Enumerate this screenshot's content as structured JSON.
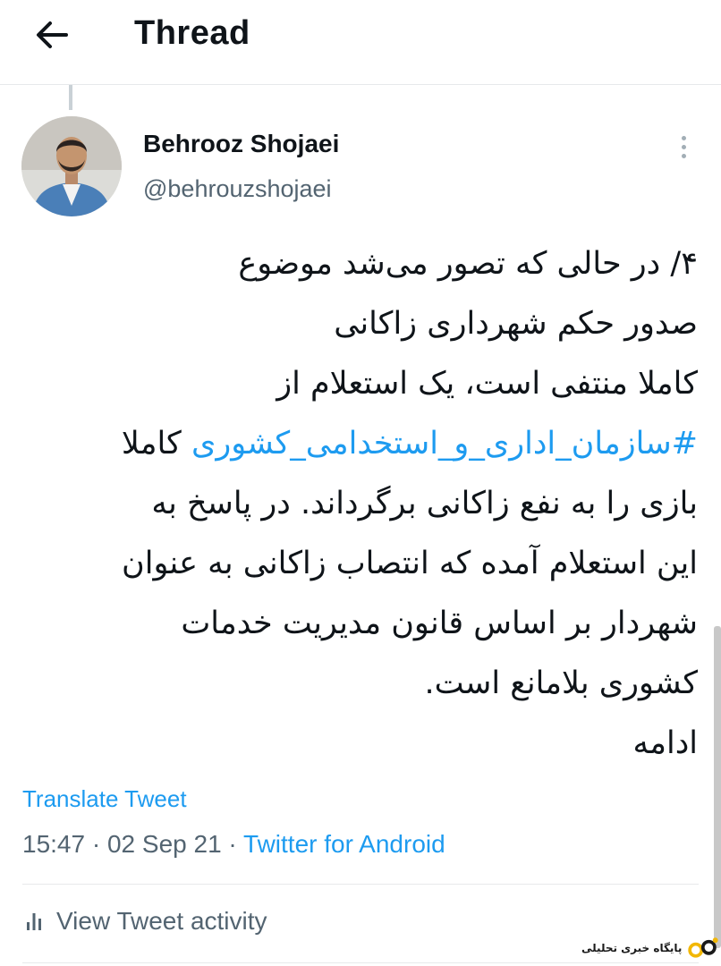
{
  "header": {
    "back_icon": "arrow-left-icon",
    "title": "Thread"
  },
  "author": {
    "name": "Behrooz Shojaei",
    "handle": "@behrouzshojaei",
    "more_icon": "more-vertical-icon"
  },
  "tweet": {
    "lines": [
      "۴/ در حالی که تصور می‌شد موضوع",
      "صدور حکم شهرداری زاکانی",
      "کاملا منتفی است، یک استعلام از"
    ],
    "hashtag": "#سازمان_اداری_و_استخدامی_کشوری",
    "hashtag_suffix": " کاملا",
    "lines_after": [
      "بازی را به نفع زاکانی برگرداند. در پاسخ به",
      "این استعلام  آمده که انتصاب زاکانی به عنوان",
      "شهردار بر اساس قانون مدیریت خدمات",
      "کشوری بلامانع است.",
      "ادامه"
    ]
  },
  "translate_label": "Translate Tweet",
  "meta": {
    "time": "15:47",
    "sep1": " · ",
    "date": "02 Sep 21",
    "sep2": " · ",
    "source": "Twitter for Android"
  },
  "activity": {
    "icon": "bar-chart-icon",
    "label": "View Tweet activity"
  },
  "watermark": {
    "text": "پایگاه خبری تحلیلی"
  },
  "colors": {
    "link": "#1d9bf0",
    "secondary_text": "#536471",
    "primary_text": "#0f1419",
    "divider": "#e7e9eb"
  }
}
